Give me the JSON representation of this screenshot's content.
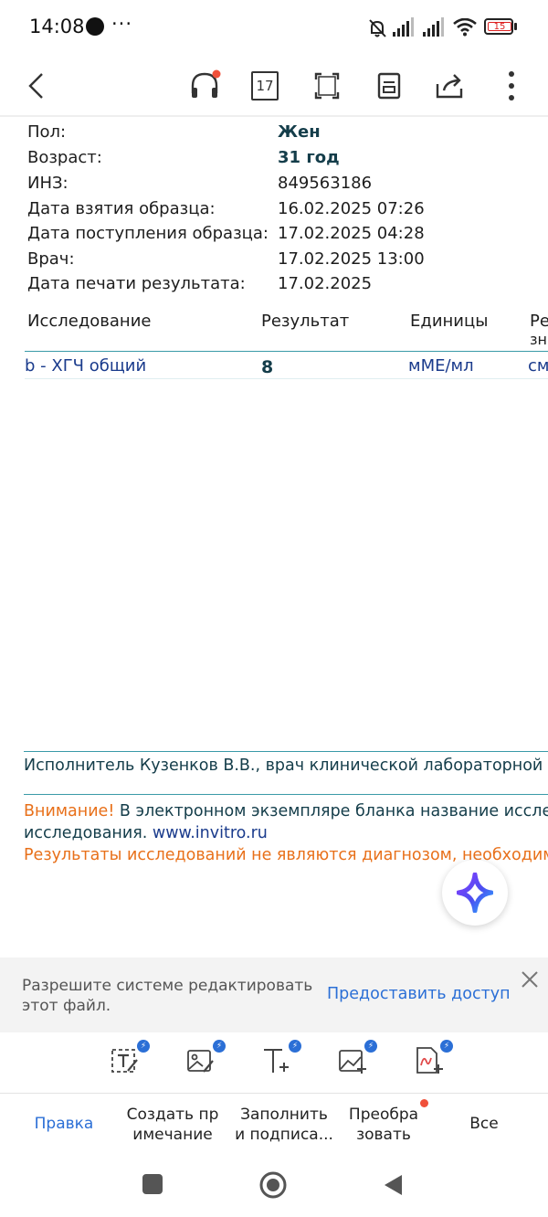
{
  "status": {
    "time": "14:08",
    "dots": "···",
    "battery": "15"
  },
  "toolbar": {
    "page_number": "17"
  },
  "document": {
    "fields": [
      {
        "label": "Пол:",
        "value": "Жен",
        "bold": true
      },
      {
        "label": "Возраст:",
        "value": "31 год",
        "bold": true
      },
      {
        "label": "ИНЗ:",
        "value": "849563186",
        "bold": false
      },
      {
        "label": "Дата взятия образца:",
        "value": "16.02.2025 07:26",
        "bold": false
      },
      {
        "label": "Дата поступления образца:",
        "value": "17.02.2025 04:28",
        "bold": false
      },
      {
        "label": "Врач:",
        "value": "17.02.2025 13:00",
        "bold": false
      },
      {
        "label": "Дата печати результата:",
        "value": "17.02.2025",
        "bold": false
      }
    ],
    "table": {
      "headers": [
        "Исследование",
        "Результат",
        "Единицы",
        "Ре",
        "зн"
      ],
      "rows": [
        {
          "test": "b - ХГЧ общий",
          "result": "8",
          "units": "мМЕ/мл",
          "reference": "см"
        }
      ]
    },
    "executor": "Исполнитель Кузенков В.В., врач клинической лабораторной ди",
    "attention_label": "Внимание!",
    "attention_text": " В электронном экземпляре бланка название исследо",
    "attention_text2": "исследования. ",
    "attention_link": "www.invitro.ru",
    "disclaimer": "Результаты исследований не являются диагнозом, необходима к"
  },
  "permission": {
    "text": "Разрешите системе редактировать этот файл.",
    "action": "Предоставить доступ"
  },
  "tabs": [
    {
      "line1": "Правка",
      "line2": ""
    },
    {
      "line1": "Создать пр",
      "line2": "имечание"
    },
    {
      "line1": "Заполнить",
      "line2": "и подписа..."
    },
    {
      "line1": "Преобра",
      "line2": "зовать"
    },
    {
      "line1": "Все",
      "line2": ""
    }
  ],
  "colors": {
    "accent": "#2b6fd6",
    "teal_rule": "#3a9aa8",
    "warning_orange": "#e8701a",
    "notification_red": "#f0503a"
  }
}
